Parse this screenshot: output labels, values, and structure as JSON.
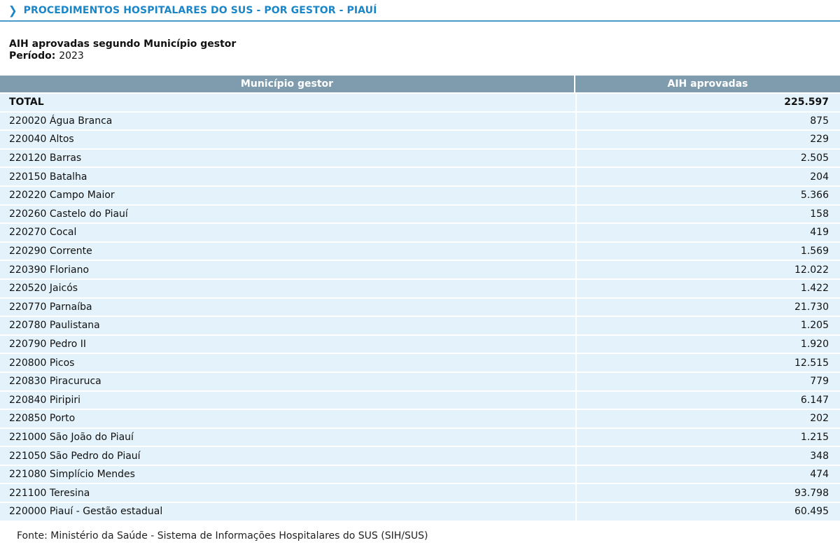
{
  "header": {
    "chevron_icon": "chevron-right-icon",
    "title": "PROCEDIMENTOS HOSPITALARES DO SUS - POR GESTOR - PIAUÍ"
  },
  "report": {
    "subtitle": "AIH aprovadas segundo Município gestor",
    "period_label": "Período:",
    "period_value": "2023"
  },
  "table": {
    "columns": [
      "Município gestor",
      "AIH aprovadas"
    ],
    "total": {
      "label": "TOTAL",
      "value": "225.597"
    },
    "rows": [
      {
        "municipio": "220020 Água Branca",
        "aih": "875"
      },
      {
        "municipio": "220040 Altos",
        "aih": "229"
      },
      {
        "municipio": "220120 Barras",
        "aih": "2.505"
      },
      {
        "municipio": "220150 Batalha",
        "aih": "204"
      },
      {
        "municipio": "220220 Campo Maior",
        "aih": "5.366"
      },
      {
        "municipio": "220260 Castelo do Piauí",
        "aih": "158"
      },
      {
        "municipio": "220270 Cocal",
        "aih": "419"
      },
      {
        "municipio": "220290 Corrente",
        "aih": "1.569"
      },
      {
        "municipio": "220390 Floriano",
        "aih": "12.022"
      },
      {
        "municipio": "220520 Jaicós",
        "aih": "1.422"
      },
      {
        "municipio": "220770 Parnaíba",
        "aih": "21.730"
      },
      {
        "municipio": "220780 Paulistana",
        "aih": "1.205"
      },
      {
        "municipio": "220790 Pedro II",
        "aih": "1.920"
      },
      {
        "municipio": "220800 Picos",
        "aih": "12.515"
      },
      {
        "municipio": "220830 Piracuruca",
        "aih": "779"
      },
      {
        "municipio": "220840 Piripiri",
        "aih": "6.147"
      },
      {
        "municipio": "220850 Porto",
        "aih": "202"
      },
      {
        "municipio": "221000 São João do Piauí",
        "aih": "1.215"
      },
      {
        "municipio": "221050 São Pedro do Piauí",
        "aih": "348"
      },
      {
        "municipio": "221080 Simplício Mendes",
        "aih": "474"
      },
      {
        "municipio": "221100 Teresina",
        "aih": "93.798"
      },
      {
        "municipio": "220000 Piauí - Gestão estadual",
        "aih": "60.495"
      }
    ]
  },
  "footer": {
    "source": "Fonte: Ministério da Saúde - Sistema de Informações Hospitalares do SUS (SIH/SUS)"
  }
}
